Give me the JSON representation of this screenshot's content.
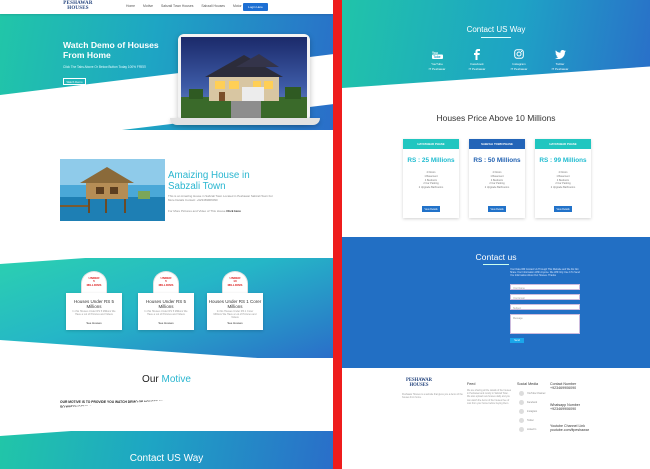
{
  "nav": {
    "logo_line1": "PESHAWAR",
    "logo_line2": "HOUSES",
    "links": [
      "Home",
      "Motive",
      "Sabzali Town Houses",
      "Sabzali Houses",
      "Motor",
      "Contact"
    ],
    "button": "Login Here"
  },
  "hero": {
    "title": "Watch Demo of Houses From Home",
    "subtitle": "Click The Tabs Above Or Below Button Today 100% FREE!",
    "button": "Watch Demo"
  },
  "amazing": {
    "title": "Amaizing House in Sabzali Town",
    "text": "This is an Amazing House in Sabzali Town Located in Peshawar Sabzali Town For More Details Contact: +923469906090",
    "link_prefix": "For More Pictures and Video of This House",
    "link_label": "Click Here"
  },
  "cards": [
    {
      "badge": [
        "UNDER",
        "5",
        "MILLIONS"
      ],
      "title": "Houses Under RS 5 Millions",
      "desc": "In this Houses Under RS 5 Millions We Have a Lot of Pictures and Videos",
      "button": "See Houses"
    },
    {
      "badge": [
        "UNDER",
        "5",
        "MILLIONS"
      ],
      "title": "Houses Under RS 5 Millions",
      "desc": "In this Houses Under RS 5 Millions We Have a Lot of Pictures and Videos",
      "button": "See Houses"
    },
    {
      "badge": [
        "UNDER",
        "10",
        "MILLIONS"
      ],
      "title": "Houses Under RS 1 Corer Millions",
      "desc": "In this Houses Under RS 1 Corer Millions We Have a Lot of Pictures and Videos",
      "button": "See Houses"
    }
  ],
  "motive": {
    "title_plain": "Our ",
    "title_accent": "Motive",
    "line1": "OUR MOTIVE IS TO PROVIDE YOU WATCH DEMO OF HOUSES FROM HOME AND SAVE YOUR TIME!",
    "line2": "SO WATCH DEMO OF THE HOUSES BEFORE BUYING 100% FREE ONLINE THROUGH OUR WEBSITE"
  },
  "left_footer_title": "Contact US Way",
  "contact_way": {
    "title": "Contact US Way",
    "socials": [
      {
        "icon": "youtube-icon",
        "name": "YouTube",
        "handle": "IT Peshawar"
      },
      {
        "icon": "facebook-icon",
        "name": "Facebook",
        "handle": "IT Peshawar"
      },
      {
        "icon": "instagram-icon",
        "name": "Instagram",
        "handle": "IT Peshawar"
      },
      {
        "icon": "twitter-icon",
        "name": "Twitter",
        "handle": "IT Peshawar"
      }
    ]
  },
  "prices": {
    "title": "Houses Price Above 10 Millions",
    "cards": [
      {
        "header": "HAYATABAD PHASE",
        "price": "RS : 25 Millions",
        "color": "#21c6c0",
        "price_color": "#20bcd0",
        "features": [
          "4 Floors",
          "1 Basement",
          "4 Bedroom",
          "2 Car Parking",
          "2 Upgrade Bathrooms"
        ],
        "button": "View Details"
      },
      {
        "header": "SABZALI TOWN PHASE",
        "price": "RS : 50 Millions",
        "color": "#2264b8",
        "price_color": "#2262b2",
        "features": [
          "4 Floors",
          "1 Basement",
          "4 Bedroom",
          "2 Car Parking",
          "2 Upgrade Bathrooms"
        ],
        "button": "View Details"
      },
      {
        "header": "HAYATABAD PHASE",
        "price": "RS : 99 Millions",
        "color": "#21c6c0",
        "price_color": "#20bcd0",
        "features": [
          "4 Floors",
          "1 Basement",
          "4 Bedroom",
          "2 Car Parking",
          "2 Upgrade Bathrooms"
        ],
        "button": "View Details"
      }
    ]
  },
  "contact_form": {
    "title": "Contact us",
    "desc": "Your Data Will Contact Us Through This Website and We Do Not Share Your Information With Anyone. We Will Only Use It To Send You Information About Our Houses. Thanks",
    "name_placeholder": "Your Name",
    "email_placeholder": "Your Email",
    "subject_placeholder": "Subject",
    "message_placeholder": "Message",
    "button": "Send"
  },
  "footer": {
    "logo_line1": "PESHAWAR",
    "logo_line2": "HOUSES",
    "about": "Peshawar Houses is a website that gives you a demo of the houses from home.",
    "feed_title": "Feed",
    "feed_text": "We are sharing all the details of the houses in Peshawar and mostly in Sabzali Town. We also upload new houses daily and you can watch the demo of the houses free of cost from your home before buying them.",
    "social_title": "Social Media",
    "social_items": [
      "YouTube Channel",
      "Facebook",
      "Instagram",
      "Twitter",
      "Linked In"
    ],
    "contact_title": "Contact Number",
    "phone": "+923469906090",
    "whatsapp_label": "Whatsapp Number",
    "whatsapp": "+923469906090",
    "youtube_label": "Youtube Channel Link",
    "youtube": "youtube.com/itpeshawar"
  }
}
